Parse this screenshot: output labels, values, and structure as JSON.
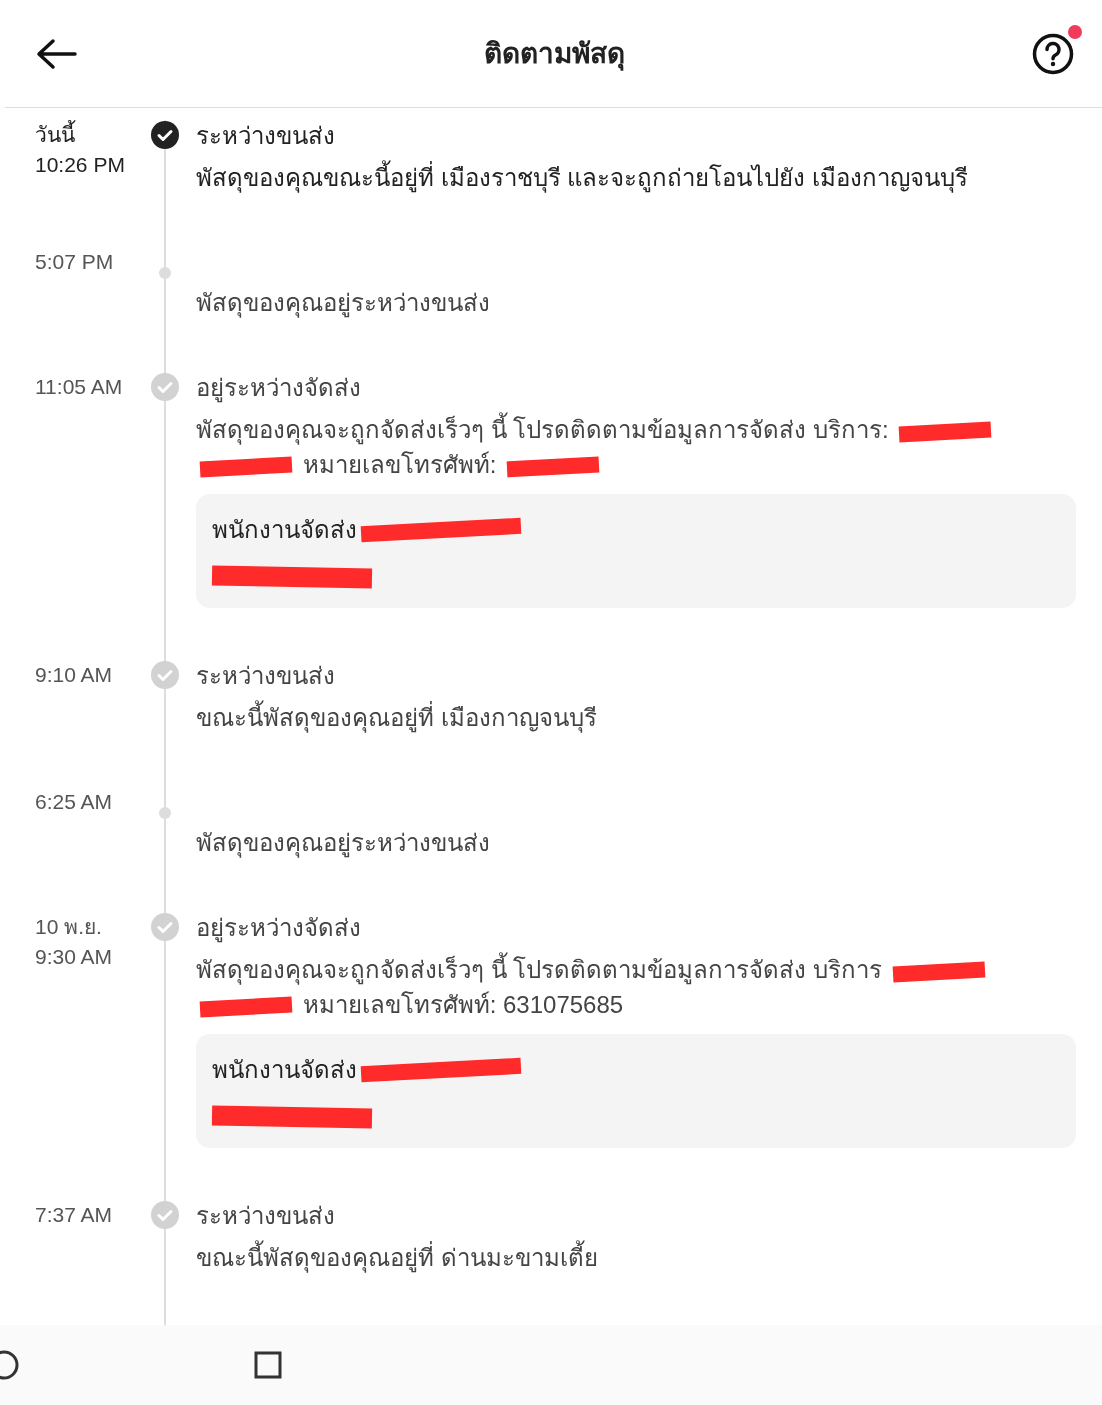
{
  "header": {
    "title": "ติดตามพัสดุ",
    "help_badge": true
  },
  "events": [
    {
      "kind": "check",
      "current": true,
      "time_lines": [
        "วันนี้",
        "10:26 PM"
      ],
      "title": "ระหว่างขนส่ง",
      "description": [
        {
          "kind": "text",
          "text": "พัสดุของคุณขณะนี้อยู่ที่ เมืองราชบุรี และจะถูกถ่ายโอนไปยัง เมืองกาญจนบุรี"
        }
      ]
    },
    {
      "kind": "dot",
      "current": false,
      "time_lines": [
        "5:07 PM"
      ],
      "description": [
        {
          "kind": "text",
          "text": "พัสดุของคุณอยู่ระหว่างขนส่ง"
        }
      ]
    },
    {
      "kind": "check",
      "current": false,
      "time_lines": [
        "11:05 AM"
      ],
      "title": "อยู่ระหว่างจัดส่ง",
      "description": [
        {
          "kind": "text",
          "text": "พัสดุของคุณจะถูกจัดส่งเร็วๆ นี้ โปรดติดตามข้อมูลการจัดส่ง บริการ:"
        },
        {
          "kind": "redaction"
        },
        {
          "kind": "redaction"
        },
        {
          "kind": "text",
          "text": "หมายเลขโทรศัพท์:"
        },
        {
          "kind": "redaction"
        }
      ],
      "courier": {
        "label": "พนักงานจัดส่ง"
      }
    },
    {
      "kind": "check",
      "current": false,
      "time_lines": [
        "9:10 AM"
      ],
      "title": "ระหว่างขนส่ง",
      "description": [
        {
          "kind": "text",
          "text": "ขณะนี้พัสดุของคุณอยู่ที่ เมืองกาญจนบุรี"
        }
      ]
    },
    {
      "kind": "dot",
      "current": false,
      "time_lines": [
        "6:25 AM"
      ],
      "description": [
        {
          "kind": "text",
          "text": "พัสดุของคุณอยู่ระหว่างขนส่ง"
        }
      ]
    },
    {
      "kind": "check",
      "current": false,
      "time_lines": [
        "10 พ.ย.",
        "9:30 AM"
      ],
      "title": "อยู่ระหว่างจัดส่ง",
      "description": [
        {
          "kind": "text",
          "text": "พัสดุของคุณจะถูกจัดส่งเร็วๆ นี้ โปรดติดตามข้อมูลการจัดส่ง บริการ"
        },
        {
          "kind": "redaction"
        },
        {
          "kind": "redaction"
        },
        {
          "kind": "text",
          "text": "หมายเลขโทรศัพท์: 631075685"
        }
      ],
      "courier": {
        "label": "พนักงานจัดส่ง"
      }
    },
    {
      "kind": "check",
      "current": false,
      "time_lines": [
        "7:37 AM"
      ],
      "title": "ระหว่างขนส่ง",
      "description": [
        {
          "kind": "text",
          "text": "ขณะนี้พัสดุของคุณอยู่ที่ ด่านมะขามเตี้ย"
        }
      ]
    }
  ]
}
